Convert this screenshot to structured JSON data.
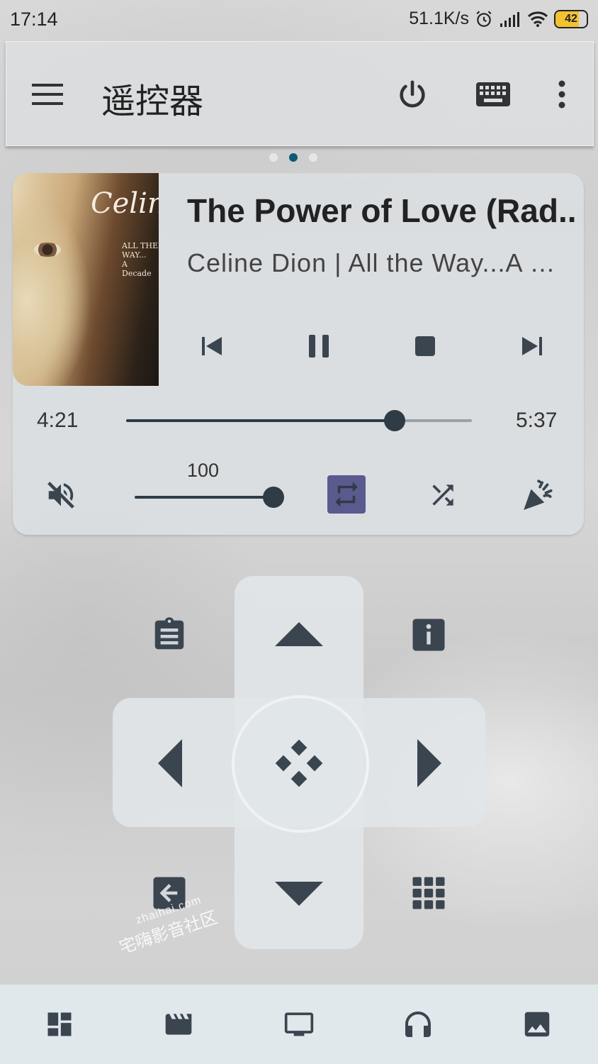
{
  "status_bar": {
    "time": "17:14",
    "net_speed": "51.1K/s",
    "battery": "42"
  },
  "app_bar": {
    "title": "遥控器",
    "icons": [
      "menu-icon",
      "power-icon",
      "keyboard-icon",
      "more-vert-icon"
    ]
  },
  "pager": {
    "count": 3,
    "active_index": 1
  },
  "player": {
    "album_art": {
      "signature": "Celine",
      "lines": [
        "ALL THE WAY...",
        "A Decade"
      ]
    },
    "song_title": "The Power of Love (Rad..",
    "artist_album": "Celine Dion | All the Way...A …",
    "elapsed": "4:21",
    "duration": "5:37",
    "progress_fraction": 0.776,
    "volume": "100",
    "volume_fraction": 1.0,
    "muted": true,
    "repeat_active": true,
    "controls": [
      "skip-previous-icon",
      "pause-icon",
      "stop-icon",
      "skip-next-icon"
    ],
    "colors": {
      "accent": "#5b5a8e",
      "icon": "#3a4550"
    }
  },
  "remote": {
    "buttons": [
      "arrow-up",
      "arrow-left",
      "select",
      "arrow-right",
      "arrow-down",
      "context-menu",
      "info",
      "back",
      "osd-grid"
    ]
  },
  "watermark": {
    "domain": "zhaihai.com",
    "name": "宅嗨影音社区"
  },
  "bottom_nav": {
    "items": [
      "dashboard-icon",
      "movies-icon",
      "tv-icon",
      "music-icon",
      "pictures-icon"
    ]
  }
}
